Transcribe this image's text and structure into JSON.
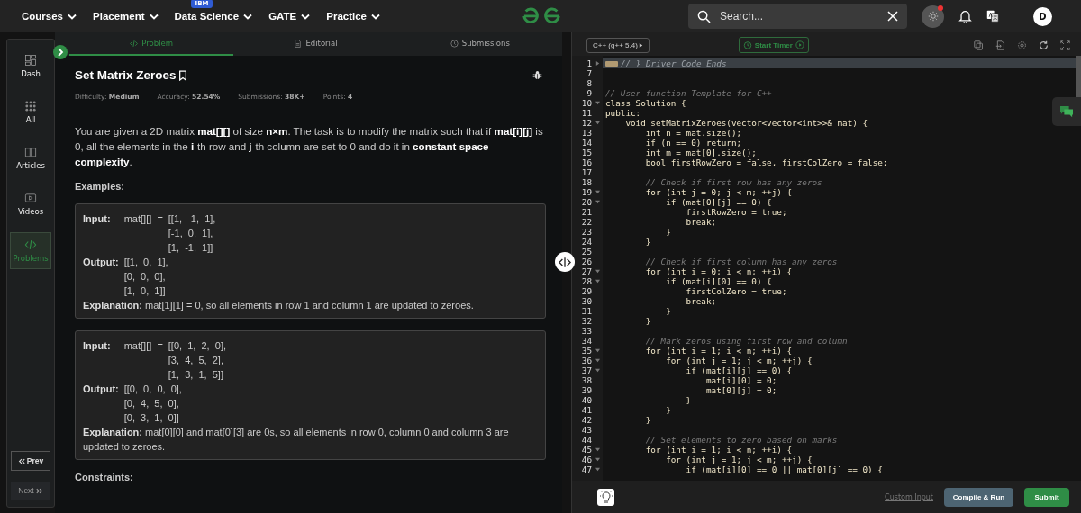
{
  "nav": {
    "items": [
      {
        "label": "Courses"
      },
      {
        "label": "Placement"
      },
      {
        "label": "Data Science",
        "badge": "IBM"
      },
      {
        "label": "GATE"
      },
      {
        "label": "Practice"
      }
    ],
    "search": {
      "placeholder": "Search..."
    },
    "notification_dot": true,
    "avatar": "D"
  },
  "sidebar": {
    "items": [
      {
        "label": "Dash",
        "selected": false
      },
      {
        "label": "All",
        "selected": false
      },
      {
        "label": "Articles",
        "selected": false
      },
      {
        "label": "Videos",
        "selected": false
      },
      {
        "label": "Problems",
        "selected": true
      }
    ],
    "prev": "Prev",
    "next": "Next"
  },
  "tabs": [
    {
      "label": "Problem",
      "selected": true
    },
    {
      "label": "Editorial",
      "selected": false
    },
    {
      "label": "Submissions",
      "selected": false
    }
  ],
  "problem": {
    "title": "Set Matrix Zeroes",
    "meta": [
      {
        "label": "Difficulty:",
        "value": "Medium"
      },
      {
        "label": "Accuracy:",
        "value": "52.54%"
      },
      {
        "label": "Submissions:",
        "value": "38K+"
      },
      {
        "label": "Points:",
        "value": "4"
      }
    ],
    "statement": "You are given a 2D matrix **mat[][]** of size **n×m**. The task is to modify the matrix such that if **mat[i][j]** is 0, all the elements in the **i**-th row and **j**-th column are set to 0 and do it in **constant space complexity**.",
    "examples_heading": "Examples:",
    "examples": [
      {
        "input_label": "Input:",
        "input_prefix": "mat[][]  =",
        "input_lines": [
          "[[1,  -1,  1],",
          "[-1,  0,  1],",
          "[1,  -1,  1]]"
        ],
        "output_label": "Output:",
        "output_lines": [
          "[[1,  0,  1],",
          "[0,  0,  0],",
          "[1,  0,  1]]"
        ],
        "explanation_label": "Explanation:",
        "explanation": "mat[1][1]  =  0,  so  all  elements  in  row  1  and  column  1  are  updated  to zeroes."
      },
      {
        "input_label": "Input:",
        "input_prefix": "mat[][]  =",
        "input_lines": [
          "[[0,  1,  2,  0],",
          "[3,  4,  5,  2],",
          "[1,  3,  1,  5]]"
        ],
        "output_label": "Output:",
        "output_lines": [
          "[[0,  0,  0,  0],",
          "[0,  4,  5,  0],",
          "[0,  3,  1,  0]]"
        ],
        "explanation_label": "Explanation:",
        "explanation": "mat[0][0]  and  mat[0][3]  are  0s,  so  all  elements  in  row  0,  column  0  and column  3  are  updated  to  zeroes."
      }
    ],
    "constraints_heading": "Constraints:"
  },
  "editor": {
    "language": "C++ (g++ 5.4)",
    "timer": "Start Timer",
    "lines": [
      {
        "n": "1",
        "kind": "collapsed",
        "fold": true,
        "text": "// } Driver Code Ends"
      },
      {
        "n": "7",
        "kind": "code",
        "fold": false
      },
      {
        "n": "8",
        "kind": "code",
        "fold": false
      },
      {
        "n": "9",
        "kind": "comment",
        "fold": false,
        "text": "// User function Template for C++"
      },
      {
        "n": "10",
        "kind": "code",
        "fold": true,
        "text": "class Solution {"
      },
      {
        "n": "11",
        "kind": "code",
        "fold": false,
        "text": "public:"
      },
      {
        "n": "12",
        "kind": "code",
        "fold": true,
        "text": "    void setMatrixZeroes(vector<vector<int>>& mat) {"
      },
      {
        "n": "13",
        "kind": "code",
        "fold": false,
        "text": "        int n = mat.size();"
      },
      {
        "n": "14",
        "kind": "code",
        "fold": false,
        "text": "        if (n == 0) return;"
      },
      {
        "n": "15",
        "kind": "code",
        "fold": false,
        "text": "        int m = mat[0].size();"
      },
      {
        "n": "16",
        "kind": "code",
        "fold": false,
        "text": "        bool firstRowZero = false, firstColZero = false;"
      },
      {
        "n": "17",
        "kind": "code",
        "fold": false
      },
      {
        "n": "18",
        "kind": "comment",
        "fold": false,
        "text": "        // Check if first row has any zeros"
      },
      {
        "n": "19",
        "kind": "code",
        "fold": true,
        "text": "        for (int j = 0; j < m; ++j) {"
      },
      {
        "n": "20",
        "kind": "code",
        "fold": true,
        "text": "            if (mat[0][j] == 0) {"
      },
      {
        "n": "21",
        "kind": "code",
        "fold": false,
        "text": "                firstRowZero = true;"
      },
      {
        "n": "22",
        "kind": "code",
        "fold": false,
        "text": "                break;"
      },
      {
        "n": "23",
        "kind": "code",
        "fold": false,
        "text": "            }"
      },
      {
        "n": "24",
        "kind": "code",
        "fold": false,
        "text": "        }"
      },
      {
        "n": "25",
        "kind": "code",
        "fold": false
      },
      {
        "n": "26",
        "kind": "comment",
        "fold": false,
        "text": "        // Check if first column has any zeros"
      },
      {
        "n": "27",
        "kind": "code",
        "fold": true,
        "text": "        for (int i = 0; i < n; ++i) {"
      },
      {
        "n": "28",
        "kind": "code",
        "fold": true,
        "text": "            if (mat[i][0] == 0) {"
      },
      {
        "n": "29",
        "kind": "code",
        "fold": false,
        "text": "                firstColZero = true;"
      },
      {
        "n": "30",
        "kind": "code",
        "fold": false,
        "text": "                break;"
      },
      {
        "n": "31",
        "kind": "code",
        "fold": false,
        "text": "            }"
      },
      {
        "n": "32",
        "kind": "code",
        "fold": false,
        "text": "        }"
      },
      {
        "n": "33",
        "kind": "code",
        "fold": false
      },
      {
        "n": "34",
        "kind": "comment",
        "fold": false,
        "text": "        // Mark zeros using first row and column"
      },
      {
        "n": "35",
        "kind": "code",
        "fold": true,
        "text": "        for (int i = 1; i < n; ++i) {"
      },
      {
        "n": "36",
        "kind": "code",
        "fold": true,
        "text": "            for (int j = 1; j < m; ++j) {"
      },
      {
        "n": "37",
        "kind": "code",
        "fold": true,
        "text": "                if (mat[i][j] == 0) {"
      },
      {
        "n": "38",
        "kind": "code",
        "fold": false,
        "text": "                    mat[i][0] = 0;"
      },
      {
        "n": "39",
        "kind": "code",
        "fold": false,
        "text": "                    mat[0][j] = 0;"
      },
      {
        "n": "40",
        "kind": "code",
        "fold": false,
        "text": "                }"
      },
      {
        "n": "41",
        "kind": "code",
        "fold": false,
        "text": "            }"
      },
      {
        "n": "42",
        "kind": "code",
        "fold": false,
        "text": "        }"
      },
      {
        "n": "43",
        "kind": "code",
        "fold": false
      },
      {
        "n": "44",
        "kind": "comment",
        "fold": false,
        "text": "        // Set elements to zero based on marks"
      },
      {
        "n": "45",
        "kind": "code",
        "fold": true,
        "text": "        for (int i = 1; i < n; ++i) {"
      },
      {
        "n": "46",
        "kind": "code",
        "fold": true,
        "text": "            for (int j = 1; j < m; ++j) {"
      },
      {
        "n": "47",
        "kind": "code",
        "fold": true,
        "text": "                if (mat[i][0] == 0 || mat[0][j] == 0) {"
      }
    ],
    "custom_input": "Custom Input",
    "compile": "Compile & Run",
    "submit": "Submit"
  }
}
